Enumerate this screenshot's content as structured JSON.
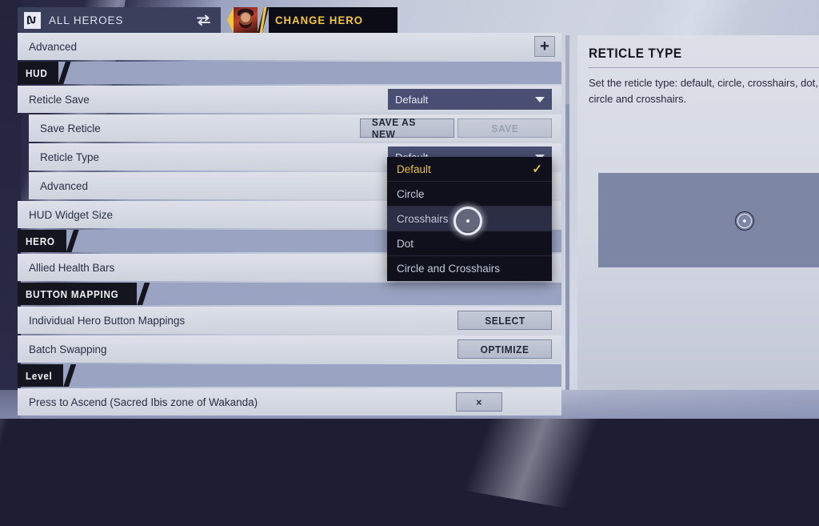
{
  "topbar": {
    "logo_icon": "nexus-glyph-icon",
    "all_heroes_label": "ALL HEROES",
    "swap_icon": "swap-arrows-icon",
    "change_hero_label": "CHANGE HERO",
    "hero_portrait": "hero-portrait-avatar"
  },
  "settings": {
    "rows": [
      {
        "kind": "row",
        "indent": false,
        "label": "Advanced",
        "control": "plus"
      },
      {
        "kind": "section",
        "label": "HUD"
      },
      {
        "kind": "row",
        "indent": false,
        "label": "Reticle Save",
        "control": "dropdown",
        "value": "Default"
      },
      {
        "kind": "row",
        "indent": true,
        "label": "Save Reticle",
        "control": "save-buttons",
        "primary": "SAVE AS NEW",
        "secondary": "SAVE"
      },
      {
        "kind": "row",
        "indent": true,
        "label": "Reticle Type",
        "control": "dropdown",
        "value": "Default"
      },
      {
        "kind": "row",
        "indent": true,
        "label": "Advanced",
        "control": "none"
      },
      {
        "kind": "row",
        "indent": false,
        "label": "HUD Widget Size",
        "control": "none"
      },
      {
        "kind": "section",
        "label": "HERO"
      },
      {
        "kind": "row",
        "indent": false,
        "label": "Allied Health Bars",
        "control": "none"
      },
      {
        "kind": "section",
        "label": "BUTTON MAPPING"
      },
      {
        "kind": "row",
        "indent": false,
        "label": "Individual Hero Button Mappings",
        "control": "button",
        "button_label": "SELECT"
      },
      {
        "kind": "row",
        "indent": false,
        "label": "Batch Swapping",
        "control": "button",
        "button_label": "OPTIMIZE"
      },
      {
        "kind": "section",
        "label": "Level"
      },
      {
        "kind": "row",
        "indent": false,
        "label": "Press to Ascend (Sacred Ibis zone of Wakanda)",
        "control": "keybind",
        "keybind": "×"
      }
    ],
    "plus_icon": "plus-icon"
  },
  "dropdown_menu": {
    "open_for": "Reticle Type",
    "check_icon": "check-icon",
    "items": [
      {
        "label": "Default",
        "selected": true,
        "hovered": false
      },
      {
        "label": "Circle",
        "selected": false,
        "hovered": false
      },
      {
        "label": "Crosshairs",
        "selected": false,
        "hovered": true
      },
      {
        "label": "Dot",
        "selected": false,
        "hovered": false
      },
      {
        "label": "Circle and Crosshairs",
        "selected": false,
        "hovered": false
      }
    ]
  },
  "info_panel": {
    "title": "RETICLE TYPE",
    "description": "Set the reticle type: default, circle, crosshairs, dot, or circle and crosshairs.",
    "preview_icon": "reticle-circle-dot-preview"
  },
  "cursor": {
    "icon": "cursor-ring-icon"
  },
  "colors": {
    "accent_yellow": "#f3c739",
    "menu_dark": "#0f101c",
    "row_light": "#dde0e9",
    "section_band": "#9aa3c2",
    "dropdown_blue": "#494f72",
    "preview_box": "#7d86a3"
  }
}
